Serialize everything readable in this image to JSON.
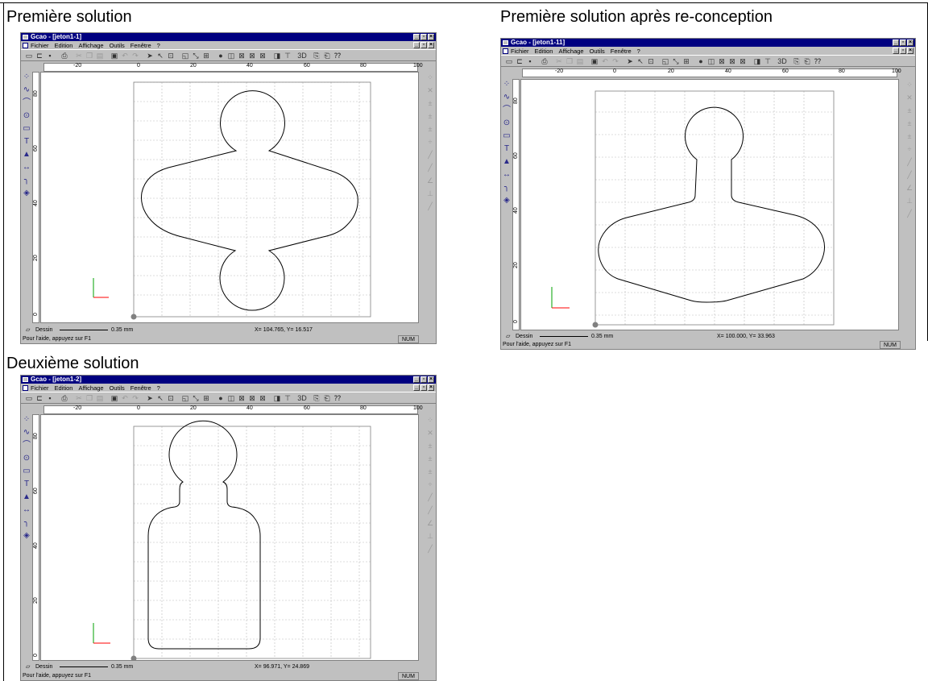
{
  "captions": {
    "first": "Première solution",
    "redesign": "Première solution après re-conception",
    "second": "Deuxième solution"
  },
  "windows": [
    {
      "id": "w1",
      "title": "Gcao - [jeton1-1]",
      "menu": [
        "Fichier",
        "Edition",
        "Affichage",
        "Outils",
        "Fenêtre",
        "?"
      ],
      "ruler_x": [
        "-20",
        "0",
        "20",
        "40",
        "60",
        "80",
        "100"
      ],
      "ruler_y": [
        "80",
        "60",
        "40",
        "20",
        "0"
      ],
      "layer": "Dessin",
      "line_width": "0.35 mm",
      "coords": "X= 104.765, Y= 16.517",
      "help": "Pour l'aide, appuyez sur F1",
      "num": "NUM"
    },
    {
      "id": "w2",
      "title": "Gcao - [jeton1-11]",
      "menu": [
        "Fichier",
        "Edition",
        "Affichage",
        "Outils",
        "Fenêtre",
        "?"
      ],
      "ruler_x": [
        "-20",
        "0",
        "20",
        "40",
        "60",
        "80",
        "100"
      ],
      "ruler_y": [
        "80",
        "60",
        "40",
        "20",
        "0"
      ],
      "layer": "Dessin",
      "line_width": "0.35 mm",
      "coords": "X= 100.000, Y= 33.963",
      "help": "Pour l'aide, appuyez sur F1",
      "num": "NUM"
    },
    {
      "id": "w3",
      "title": "Gcao - [jeton1-2]",
      "menu": [
        "Fichier",
        "Edition",
        "Affichage",
        "Outils",
        "Fenêtre",
        "?"
      ],
      "ruler_x": [
        "-20",
        "0",
        "20",
        "40",
        "60",
        "80",
        "100"
      ],
      "ruler_y": [
        "80",
        "60",
        "40",
        "20",
        "0"
      ],
      "layer": "Dessin",
      "line_width": "0.35 mm",
      "coords": "X= 96.971, Y= 24.869",
      "help": "Pour l'aide, appuyez sur F1",
      "num": "NUM"
    }
  ],
  "toolbar_icons": [
    "new-icon",
    "open-icon",
    "save-icon",
    "print-icon",
    "cut-icon",
    "copy-icon",
    "paste-icon",
    "select-icon",
    "zoom-icon",
    "view-xy-icon",
    "view-xz-icon",
    "view-yz-icon",
    "3d-icon",
    "help-icon"
  ],
  "left_tool_icons": [
    "point-icon",
    "polyline-icon",
    "arc-icon",
    "circle-icon",
    "rectangle-icon",
    "text-icon",
    "hatch-icon",
    "dimension-icon",
    "fillet-icon",
    "fill-icon"
  ],
  "axis_colors": {
    "x": "#ff0000",
    "y": "#00a000"
  },
  "titlebar_color": "#000080"
}
